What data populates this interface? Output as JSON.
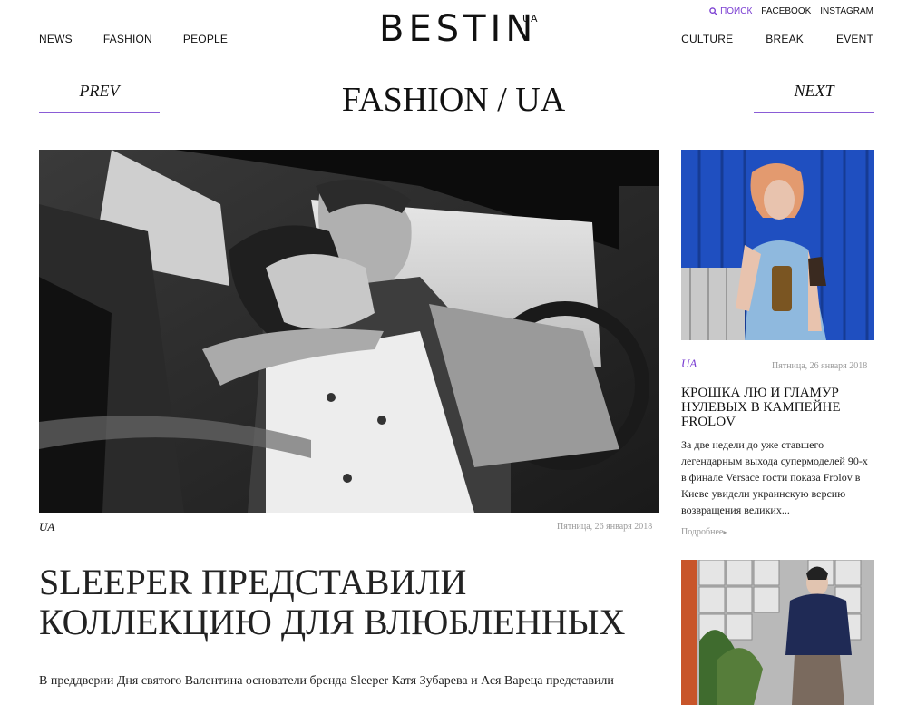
{
  "header": {
    "logo_text": "BESTIN",
    "logo_sup": "UA",
    "search_label": "ПОИСК",
    "facebook": "FACEBOOK",
    "instagram": "INSTAGRAM",
    "nav_left": [
      "NEWS",
      "FASHION",
      "PEOPLE"
    ],
    "nav_right": [
      "CULTURE",
      "BREAK",
      "EVENT"
    ]
  },
  "pager": {
    "prev": "PREV",
    "next": "NEXT",
    "section_title": "FASHION / UA"
  },
  "article": {
    "tag": "UA",
    "date": "Пятница, 26 января 2018",
    "title": "SLEEPER ПРЕДСТАВИЛИ КОЛЛЕКЦИЮ ДЛЯ ВЛЮБЛЕННЫХ",
    "lead": "В преддверии Дня святого Валентина основатели бренда Sleeper Катя Зубарева и Ася Вареца представили"
  },
  "sidebar": {
    "card1": {
      "tag": "UA",
      "date": "Пятница, 26 января 2018",
      "title": "КРОШКА ЛЮ И ГЛАМУР НУЛЕВЫХ В КАМПЕЙНЕ FROLOV",
      "text": "За две недели до уже ставшего легендарным выхода супермоделей 90-х в финале Versace гости показа Frolov в Киеве увидели украинскую версию возвращения великих...",
      "more": "Подробнее"
    }
  },
  "colors": {
    "accent": "#7b3fd2",
    "underline": "#8a5cd6",
    "muted": "#999999"
  }
}
